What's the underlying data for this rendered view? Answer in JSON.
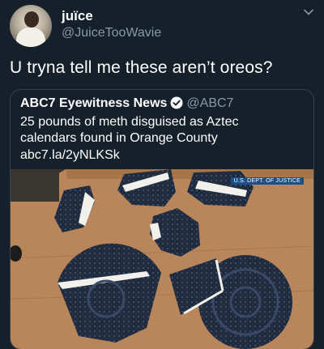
{
  "user": {
    "display_name": "juïce",
    "handle": "@JuiceTooWavie"
  },
  "tweet": {
    "text": "U tryna tell me these aren’t oreos?"
  },
  "quoted_tweet": {
    "name": "ABC7 Eyewitness News",
    "handle": "@ABC7",
    "text": "25 pounds of meth disguised as Aztec calendars found in Orange County",
    "link": "abc7.la/2yNLKSk",
    "photo_label": "U.S. DEPT. OF JUSTICE"
  },
  "icons": {
    "menu": "chevron-down-icon",
    "verified": "verified-badge-icon"
  },
  "colors": {
    "background": "#15202b",
    "secondary_text": "#8899a6",
    "border": "#38444d",
    "verified": "#1da1f2"
  }
}
